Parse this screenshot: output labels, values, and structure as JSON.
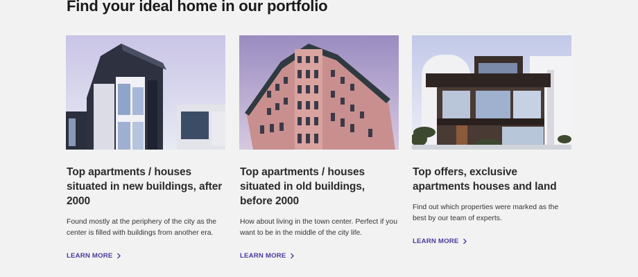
{
  "section": {
    "title": "Find your ideal home in our portfolio"
  },
  "cards": [
    {
      "image_alt": "modern-apartment-building-photo",
      "title": "Top apartments / houses situated in new buildings, after 2000",
      "description": "Found mostly at the periphery of the city as the center is filled with buildings from another era.",
      "cta": "LEARN MORE"
    },
    {
      "image_alt": "historic-corner-building-photo",
      "title": "Top apartments / houses situated in old buildings, before 2000",
      "description": "How about living in the town center. Perfect if you want to be in the middle of the city life.",
      "cta": "LEARN MORE"
    },
    {
      "image_alt": "modern-villa-photo",
      "title": "Top offers, exclusive apartments houses and land",
      "description": "Find out which properties were marked as the best by our team of experts.",
      "cta": "LEARN MORE"
    }
  ],
  "colors": {
    "accent": "#4b3a9c",
    "background": "#f2f2f2",
    "heading": "#1a1a1a"
  },
  "icons": {
    "cta_icon": "chevron-right-icon"
  }
}
